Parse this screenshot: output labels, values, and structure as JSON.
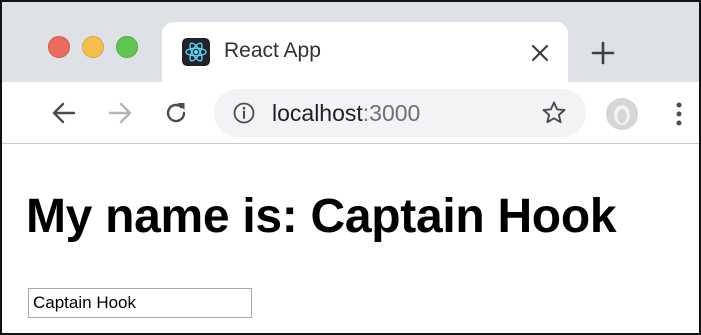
{
  "browser": {
    "tab": {
      "title": "React App",
      "favicon": "react-logo-icon"
    },
    "address_bar": {
      "host": "localhost",
      "port": ":3000"
    },
    "icons": {
      "back": "arrow-left-icon",
      "forward": "arrow-right-icon",
      "reload": "reload-icon",
      "site_info": "info-icon",
      "bookmark": "star-icon",
      "profile": "profile-avatar-icon",
      "menu": "kebab-menu-icon",
      "tab_close": "close-icon",
      "new_tab": "plus-icon"
    },
    "colors": {
      "tab_strip": "#dee1e6",
      "omnibox": "#f1f3f4",
      "traffic_close": "#ed6a5e",
      "traffic_minimize": "#f5bf4f",
      "traffic_maximize": "#61c554",
      "react_blue": "#61dafb"
    }
  },
  "page": {
    "heading": "My name is: Captain Hook",
    "name_input": {
      "value": "Captain Hook"
    }
  }
}
